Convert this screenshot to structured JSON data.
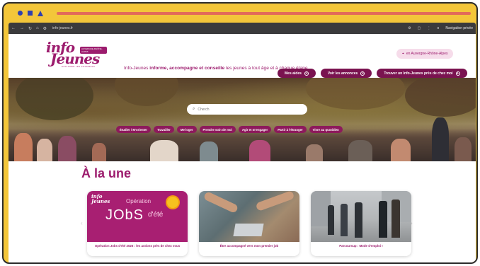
{
  "browser": {
    "url": "info-jeunes.fr",
    "private_label": "Navigation privée"
  },
  "header": {
    "logo_line1": "info",
    "logo_line2": "Jeunes",
    "logo_badge": "AUVERGNE-RHÔNE-ALPES",
    "logo_sub": "EXPLORER LES POSSIBLES",
    "tagline_pre": "Info-Jeunes ",
    "tagline_bold": "informe, accompagne et conseille",
    "tagline_post": " les jeunes à tout âge et à chaque étape",
    "region": "en Auvergne-Rhône-Alpes"
  },
  "menu": {
    "items": [
      {
        "label": "Mes aides"
      },
      {
        "label": "Voir les annonces"
      },
      {
        "label": "Trouver un Info-Jeunes près de chez moi"
      }
    ]
  },
  "hero": {
    "search_placeholder": "Cherch",
    "chips": [
      {
        "label": "Étudier / M'orienter"
      },
      {
        "label": "Travailler"
      },
      {
        "label": "Me loger"
      },
      {
        "label": "Prendre soin de moi"
      },
      {
        "label": "Agir et m'engager"
      },
      {
        "label": "Partir à l'étranger"
      },
      {
        "label": "Vivre au quotidien"
      }
    ]
  },
  "une": {
    "title": "À la une",
    "cards": [
      {
        "title": "Opération Jobs d'été 2025 : les actions près de chez vous",
        "img_logo": "info\nJeunes",
        "img_op": "Opération",
        "img_jobs": "JObS",
        "img_ete": "d'été"
      },
      {
        "title": "Être accompagné vers mon premier job"
      },
      {
        "title": "Parcoursup : Mode d'emploi !"
      }
    ]
  },
  "colors": {
    "brand": "#9c1b6d",
    "menu_button": "#7a1350",
    "frame": "#f3c63a",
    "frame_accent": "#2f3fae"
  }
}
